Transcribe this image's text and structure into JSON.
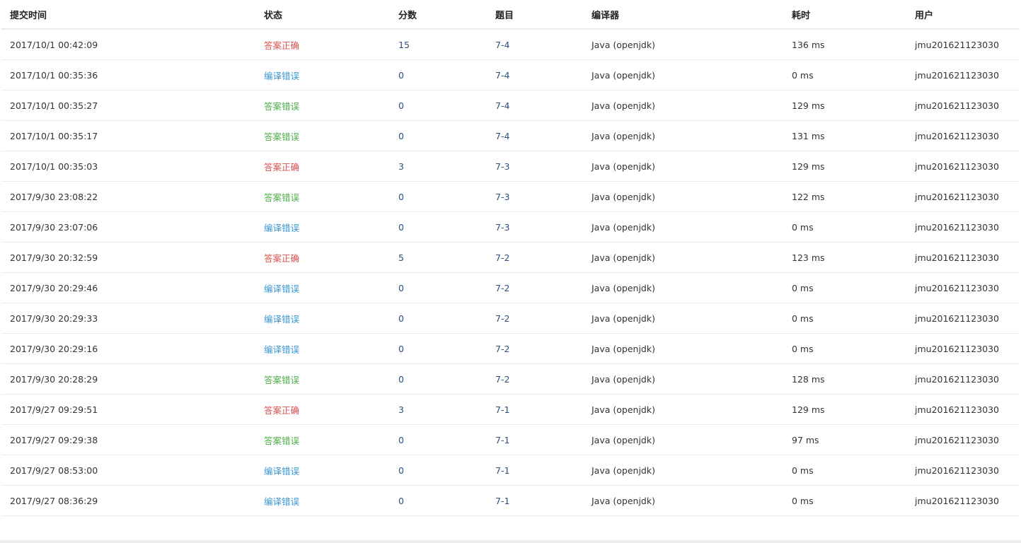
{
  "columns": {
    "time": "提交时间",
    "status": "状态",
    "score": "分数",
    "problem": "题目",
    "compiler": "编译器",
    "cost": "耗时",
    "user": "用户"
  },
  "status_colors": {
    "答案正确": "#d9534f",
    "编译错误": "#3a97d4",
    "答案错误": "#4cae4c"
  },
  "rows": [
    {
      "time": "2017/10/1 00:42:09",
      "status": "答案正确",
      "score": "15",
      "problem": "7-4",
      "compiler": "Java (openjdk)",
      "cost": "136 ms",
      "user": "jmu201621123030"
    },
    {
      "time": "2017/10/1 00:35:36",
      "status": "编译错误",
      "score": "0",
      "problem": "7-4",
      "compiler": "Java (openjdk)",
      "cost": "0 ms",
      "user": "jmu201621123030"
    },
    {
      "time": "2017/10/1 00:35:27",
      "status": "答案错误",
      "score": "0",
      "problem": "7-4",
      "compiler": "Java (openjdk)",
      "cost": "129 ms",
      "user": "jmu201621123030"
    },
    {
      "time": "2017/10/1 00:35:17",
      "status": "答案错误",
      "score": "0",
      "problem": "7-4",
      "compiler": "Java (openjdk)",
      "cost": "131 ms",
      "user": "jmu201621123030"
    },
    {
      "time": "2017/10/1 00:35:03",
      "status": "答案正确",
      "score": "3",
      "problem": "7-3",
      "compiler": "Java (openjdk)",
      "cost": "129 ms",
      "user": "jmu201621123030"
    },
    {
      "time": "2017/9/30 23:08:22",
      "status": "答案错误",
      "score": "0",
      "problem": "7-3",
      "compiler": "Java (openjdk)",
      "cost": "122 ms",
      "user": "jmu201621123030"
    },
    {
      "time": "2017/9/30 23:07:06",
      "status": "编译错误",
      "score": "0",
      "problem": "7-3",
      "compiler": "Java (openjdk)",
      "cost": "0 ms",
      "user": "jmu201621123030"
    },
    {
      "time": "2017/9/30 20:32:59",
      "status": "答案正确",
      "score": "5",
      "problem": "7-2",
      "compiler": "Java (openjdk)",
      "cost": "123 ms",
      "user": "jmu201621123030"
    },
    {
      "time": "2017/9/30 20:29:46",
      "status": "编译错误",
      "score": "0",
      "problem": "7-2",
      "compiler": "Java (openjdk)",
      "cost": "0 ms",
      "user": "jmu201621123030"
    },
    {
      "time": "2017/9/30 20:29:33",
      "status": "编译错误",
      "score": "0",
      "problem": "7-2",
      "compiler": "Java (openjdk)",
      "cost": "0 ms",
      "user": "jmu201621123030"
    },
    {
      "time": "2017/9/30 20:29:16",
      "status": "编译错误",
      "score": "0",
      "problem": "7-2",
      "compiler": "Java (openjdk)",
      "cost": "0 ms",
      "user": "jmu201621123030"
    },
    {
      "time": "2017/9/30 20:28:29",
      "status": "答案错误",
      "score": "0",
      "problem": "7-2",
      "compiler": "Java (openjdk)",
      "cost": "128 ms",
      "user": "jmu201621123030"
    },
    {
      "time": "2017/9/27 09:29:51",
      "status": "答案正确",
      "score": "3",
      "problem": "7-1",
      "compiler": "Java (openjdk)",
      "cost": "129 ms",
      "user": "jmu201621123030"
    },
    {
      "time": "2017/9/27 09:29:38",
      "status": "答案错误",
      "score": "0",
      "problem": "7-1",
      "compiler": "Java (openjdk)",
      "cost": "97 ms",
      "user": "jmu201621123030"
    },
    {
      "time": "2017/9/27 08:53:00",
      "status": "编译错误",
      "score": "0",
      "problem": "7-1",
      "compiler": "Java (openjdk)",
      "cost": "0 ms",
      "user": "jmu201621123030"
    },
    {
      "time": "2017/9/27 08:36:29",
      "status": "编译错误",
      "score": "0",
      "problem": "7-1",
      "compiler": "Java (openjdk)",
      "cost": "0 ms",
      "user": "jmu201621123030"
    }
  ]
}
